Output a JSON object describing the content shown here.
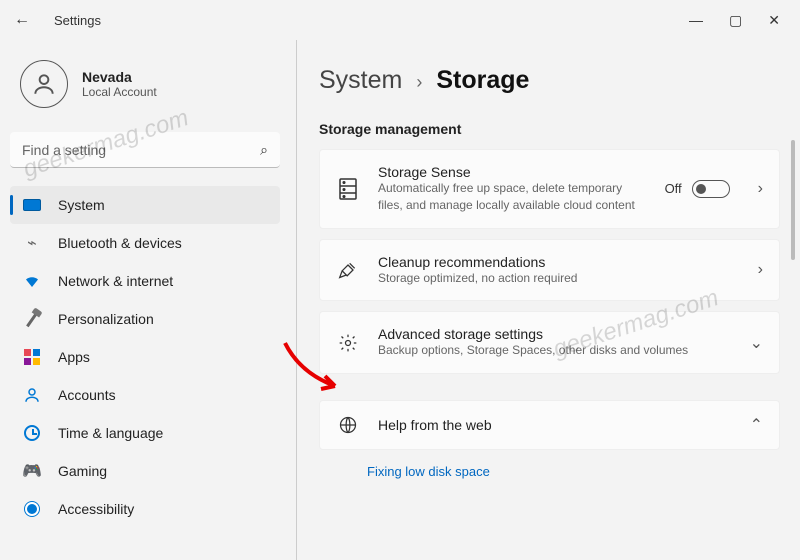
{
  "app_title": "Settings",
  "user": {
    "name": "Nevada",
    "sub": "Local Account"
  },
  "search": {
    "placeholder": "Find a setting"
  },
  "nav": [
    {
      "label": "System"
    },
    {
      "label": "Bluetooth & devices"
    },
    {
      "label": "Network & internet"
    },
    {
      "label": "Personalization"
    },
    {
      "label": "Apps"
    },
    {
      "label": "Accounts"
    },
    {
      "label": "Time & language"
    },
    {
      "label": "Gaming"
    },
    {
      "label": "Accessibility"
    }
  ],
  "breadcrumb": {
    "parent": "System",
    "current": "Storage"
  },
  "section_title": "Storage management",
  "cards": {
    "sense": {
      "title": "Storage Sense",
      "sub": "Automatically free up space, delete temporary files, and manage locally available cloud content",
      "toggle_label": "Off"
    },
    "cleanup": {
      "title": "Cleanup recommendations",
      "sub": "Storage optimized, no action required"
    },
    "advanced": {
      "title": "Advanced storage settings",
      "sub": "Backup options, Storage Spaces, other disks and volumes"
    },
    "help": {
      "title": "Help from the web",
      "link": "Fixing low disk space"
    }
  },
  "watermark": "geekermag.com"
}
